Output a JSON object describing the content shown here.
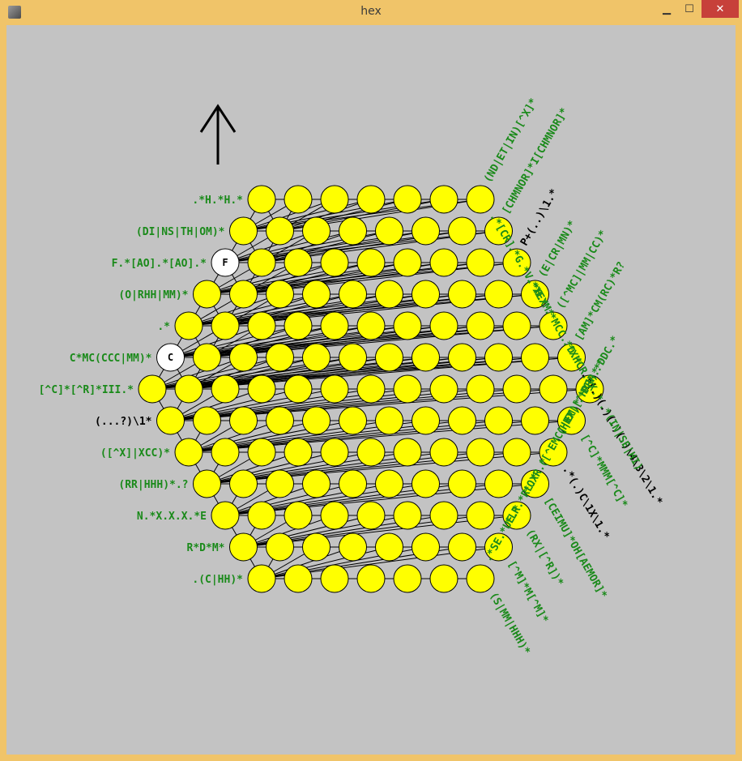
{
  "window": {
    "title": "hex",
    "minimize_glyph": "▁",
    "maximize_glyph": "☐",
    "close_glyph": "✕"
  },
  "colors": {
    "cell_fill": "#ffff00",
    "solved_fill": "#ffffff",
    "clue_green": "#1a8a1a",
    "clue_black": "#000000",
    "canvas_bg": "#c3c3c3"
  },
  "icons": {
    "direction": "up-arrow-icon"
  },
  "grid": {
    "rows": 13,
    "filled_cells": [
      {
        "row": 2,
        "col": 0,
        "letter": "F"
      },
      {
        "row": 5,
        "col": 0,
        "letter": "C"
      }
    ]
  },
  "clues": {
    "left": [
      {
        "text": ".*H.*H.*",
        "solved": false
      },
      {
        "text": "(DI|NS|TH|OM)*",
        "solved": false
      },
      {
        "text": "F.*[AO].*[AO].*",
        "solved": false
      },
      {
        "text": "(O|RHH|MM)*",
        "solved": false
      },
      {
        "text": ".*",
        "solved": false
      },
      {
        "text": "C*MC(CCC|MM)*",
        "solved": false
      },
      {
        "text": "[^C]*[^R]*III.*",
        "solved": false
      },
      {
        "text": "(...?)\\1*",
        "solved": true
      },
      {
        "text": "([^X]|XCC)*",
        "solved": false
      },
      {
        "text": "(RR|HHH)*.?",
        "solved": false
      },
      {
        "text": "N.*X.X.X.*E",
        "solved": false
      },
      {
        "text": "R*D*M*",
        "solved": false
      },
      {
        "text": ".(C|HH)*",
        "solved": false
      }
    ],
    "top": [
      {
        "text": ".*[CR]",
        "solved": false
      },
      {
        "text": ".*G.*V.*H.*",
        "solved": false
      },
      {
        "text": ".*XEXM*",
        "solved": false
      },
      {
        "text": ".*MCC.*D.*",
        "solved": false
      },
      {
        "text": ".*XHCR.*X.*",
        "solved": false
      },
      {
        "text": ".*(.)(.)(.)(.)\\4\\3\\2\\1.*",
        "solved": true
      },
      {
        "text": ".*(IN|SE|HI)",
        "solved": false
      },
      {
        "text": "[^C]*MMM[^C]*",
        "solved": false
      },
      {
        "text": ".*(.)C\\1X\\1.*",
        "solved": true
      },
      {
        "text": "[CEIMU]*OH[AEMOR]*",
        "solved": false
      },
      {
        "text": "(RX|[^R])*",
        "solved": false
      },
      {
        "text": "[^M]*M[^M]*",
        "solved": false
      },
      {
        "text": "(S|MM|HHH)*",
        "solved": false
      }
    ],
    "bottom": [
      {
        "text": ".*SE.*UE.*",
        "solved": false
      },
      {
        "text": ".*LR.*RL.*",
        "solved": false
      },
      {
        "text": ".*OXR.*",
        "solved": false
      },
      {
        "text": "([^EMC]|EM)*",
        "solved": false
      },
      {
        "text": "(HHX|[^HX])*",
        "solved": false
      },
      {
        "text": ".*PRR.*DDC.*",
        "solved": false
      },
      {
        "text": ".*",
        "solved": false
      },
      {
        "text": "[AM]*CM(RC)*R?",
        "solved": false
      },
      {
        "text": "([^MC]|MM|CC)*",
        "solved": false
      },
      {
        "text": "(E|CR|MN)*",
        "solved": false
      },
      {
        "text": "P+(..)\\1.*",
        "solved": true
      },
      {
        "text": "[CHMNOR]*I[CHMNOR]*",
        "solved": false
      },
      {
        "text": "(ND|ET|IN)[^X]*",
        "solved": false
      }
    ]
  }
}
